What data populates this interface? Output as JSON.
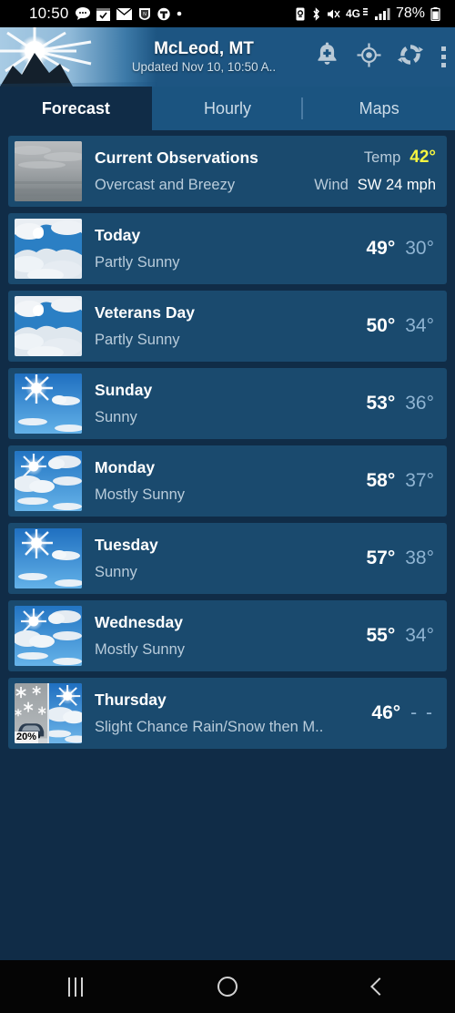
{
  "status_bar": {
    "time": "10:50",
    "battery_pct": "78%",
    "network": "4G",
    "left_icons": [
      "message-icon",
      "checklist-icon",
      "mail-icon",
      "nfl-shield-icon",
      "t-mobile-icon",
      "dot-icon"
    ],
    "right_icons": [
      "battery-saver-icon",
      "bluetooth-icon",
      "mute-vibrate-icon",
      "network-4g-icon",
      "signal-bars-icon",
      "battery-icon"
    ]
  },
  "header": {
    "title": "McLeod, MT",
    "subtitle": "Updated Nov 10, 10:50 A..",
    "logo": "sunrise-mountain-logo",
    "actions": [
      {
        "name": "add-alert-icon",
        "label": "Add Alert"
      },
      {
        "name": "current-location-icon",
        "label": "Current Location"
      },
      {
        "name": "refresh-icon",
        "label": "Refresh"
      },
      {
        "name": "overflow-menu-icon",
        "label": "More options"
      }
    ]
  },
  "tabs": [
    {
      "label": "Forecast",
      "active": true
    },
    {
      "label": "Hourly",
      "active": false
    },
    {
      "label": "Maps",
      "active": false
    }
  ],
  "observations": {
    "title": "Current Observations",
    "description": "Overcast and Breezy",
    "temp_label": "Temp",
    "temp_value": "42°",
    "wind_label": "Wind",
    "wind_value": "SW 24 mph",
    "icon": "overcast-sky-photo"
  },
  "forecast": [
    {
      "day": "Today",
      "desc": "Partly Sunny",
      "hi": "49°",
      "lo": "30°",
      "icon": "partly-sunny-icon"
    },
    {
      "day": "Veterans Day",
      "desc": "Partly Sunny",
      "hi": "50°",
      "lo": "34°",
      "icon": "partly-sunny-icon"
    },
    {
      "day": "Sunday",
      "desc": "Sunny",
      "hi": "53°",
      "lo": "36°",
      "icon": "sunny-icon"
    },
    {
      "day": "Monday",
      "desc": "Mostly Sunny",
      "hi": "58°",
      "lo": "37°",
      "icon": "mostly-sunny-icon"
    },
    {
      "day": "Tuesday",
      "desc": "Sunny",
      "hi": "57°",
      "lo": "38°",
      "icon": "sunny-icon"
    },
    {
      "day": "Wednesday",
      "desc": "Mostly Sunny",
      "hi": "55°",
      "lo": "34°",
      "icon": "mostly-sunny-icon"
    },
    {
      "day": "Thursday",
      "desc": "Slight Chance Rain/Snow then M..",
      "hi": "46°",
      "lo": "- -",
      "icon": "snow-then-sunny-split-icon",
      "precip": "20%"
    }
  ],
  "nav_bar": {
    "recents": "recents-icon",
    "home": "home-icon",
    "back": "back-icon"
  },
  "colors": {
    "page_bg": "#102c47",
    "card_bg": "#1a4a6e",
    "header_bg": "#1d5582",
    "tab_bar_bg": "#1b5480",
    "temp_accent": "#f5f540",
    "low_temp": "#8fb4d2"
  }
}
